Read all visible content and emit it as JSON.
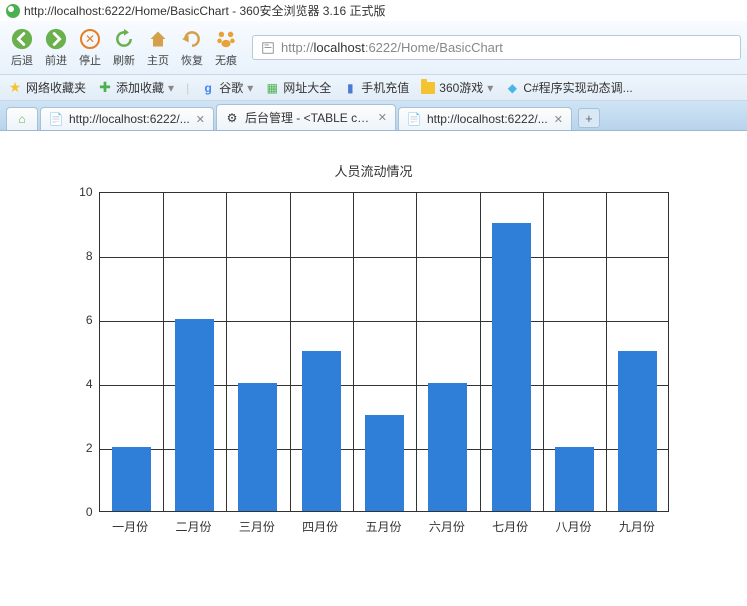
{
  "window": {
    "title": "http://localhost:6222/Home/BasicChart - 360安全浏览器 3.16 正式版"
  },
  "toolbar": {
    "back": "后退",
    "forward": "前进",
    "stop": "停止",
    "refresh": "刷新",
    "home": "主页",
    "restore": "恢复",
    "incognito": "无痕"
  },
  "addressbar": {
    "scheme": "http://",
    "host": "localhost",
    "rest": ":6222/Home/BasicChart"
  },
  "bookmarks": {
    "fav_label": "网络收藏夹",
    "add_fav": "添加收藏",
    "google": "谷歌",
    "sites": "网址大全",
    "recharge": "手机充值",
    "games": "360游戏",
    "csharp": "C#程序实现动态调..."
  },
  "tabs": [
    {
      "label": "http://localhost:6222/..."
    },
    {
      "label": "后台管理 - <TABLE cel..."
    },
    {
      "label": "http://localhost:6222/..."
    }
  ],
  "chart_data": {
    "type": "bar",
    "title": "人员流动情况",
    "categories": [
      "一月份",
      "二月份",
      "三月份",
      "四月份",
      "五月份",
      "六月份",
      "七月份",
      "八月份",
      "九月份"
    ],
    "values": [
      2,
      6,
      4,
      5,
      3,
      4,
      9,
      2,
      5
    ],
    "ylim": [
      0,
      10
    ],
    "yticks": [
      0,
      2,
      4,
      6,
      8,
      10
    ],
    "bar_color": "#2f7ed8"
  }
}
